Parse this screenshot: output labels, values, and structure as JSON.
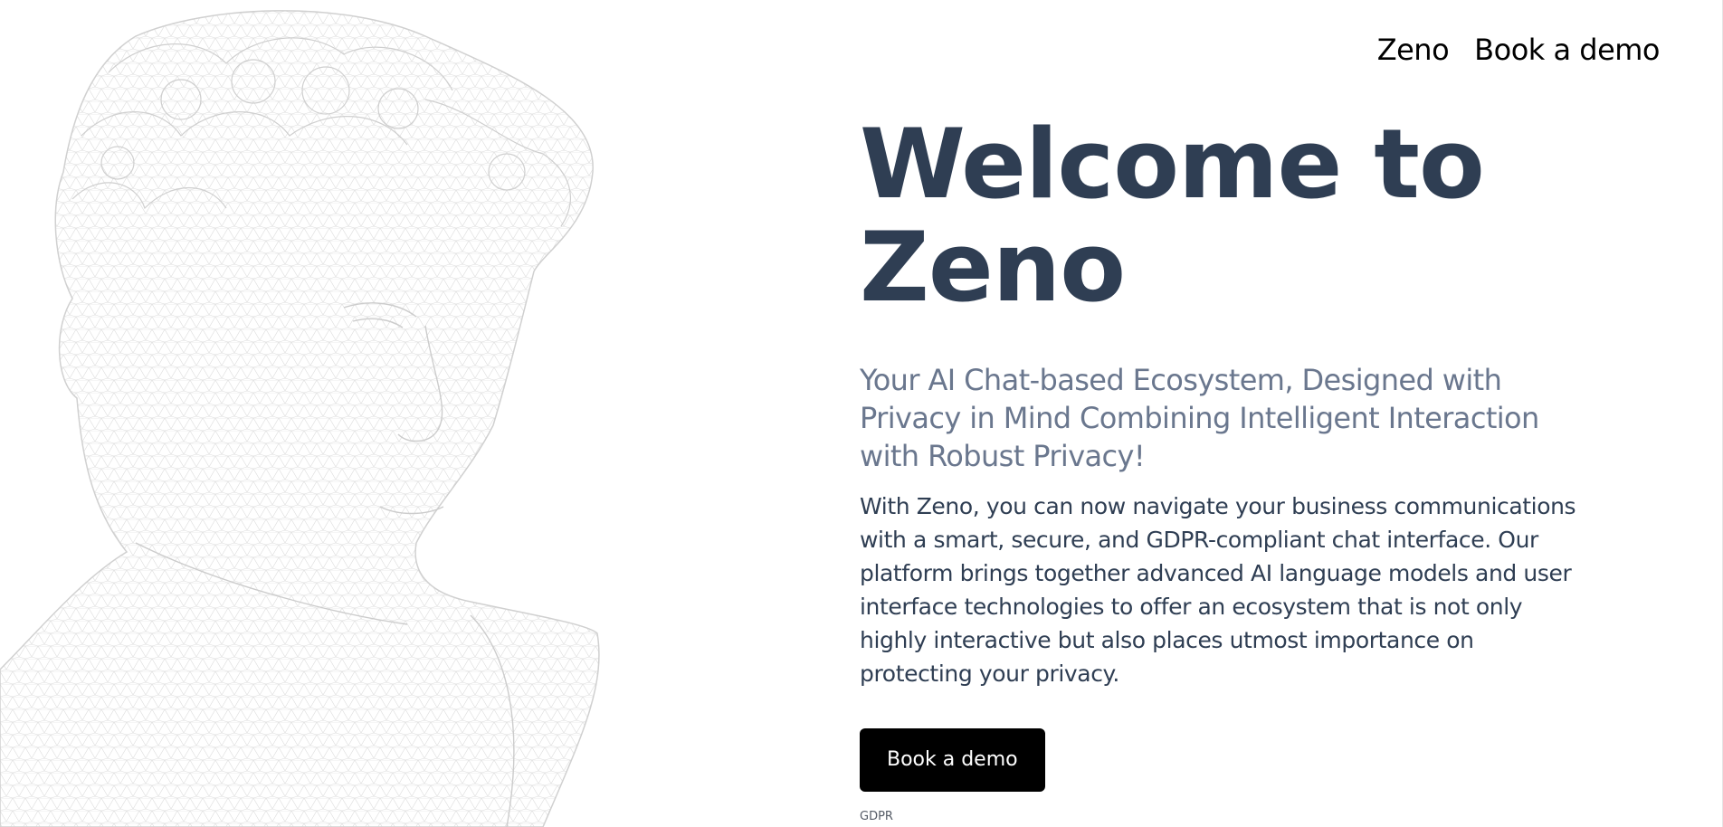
{
  "nav": {
    "items": [
      {
        "label": "Zeno"
      },
      {
        "label": "Book a demo"
      }
    ]
  },
  "hero": {
    "title_line1": "Welcome to",
    "title_line2": "Zeno",
    "subtitle": "Your AI Chat-based Ecosystem, Designed with Privacy in Mind Combining Intelligent Interaction with Robust Privacy!",
    "description": "With Zeno, you can now navigate your business communications with a smart, secure, and GDPR-compliant chat interface. Our platform brings together advanced AI language models and user interface technologies to offer an ecosystem that is not only highly interactive but also places utmost importance on protecting your privacy.",
    "cta_label": "Book a demo"
  },
  "footer": {
    "gdpr_label": "GDPR"
  },
  "colors": {
    "title": "#2f3e53",
    "subtitle": "#6a778e",
    "body_text": "#2f3e53",
    "cta_background": "#000000",
    "cta_text": "#ffffff",
    "wireframe": "#d9d9d9"
  },
  "icons": {
    "hero_image": "wireframe-bust-illustration"
  }
}
